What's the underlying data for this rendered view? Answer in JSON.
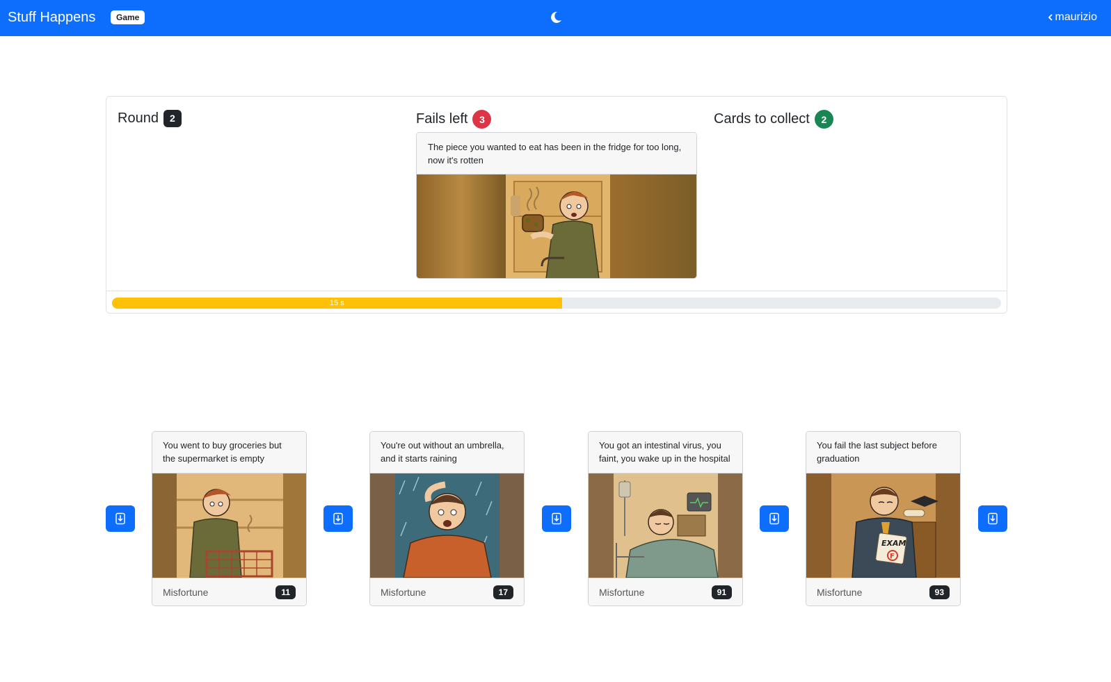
{
  "navbar": {
    "brand": "Stuff Happens",
    "badge": "Game",
    "theme_icon": "moon-icon",
    "user": "maurizio",
    "user_icon": "chevron-left-icon"
  },
  "game": {
    "round_label": "Round",
    "round_value": "2",
    "fails_label": "Fails left",
    "fails_value": "3",
    "collect_label": "Cards to collect",
    "collect_value": "2",
    "current_card": {
      "text": "The piece you wanted to eat has been in the fridge for too long, now it's rotten"
    },
    "timer": {
      "label": "15 s",
      "fraction": 0.506
    }
  },
  "hand": [
    {
      "text": "You went to buy groceries but the supermarket is empty",
      "category": "Misfortune",
      "index": "11"
    },
    {
      "text": "You're out without an umbrella, and it starts raining",
      "category": "Misfortune",
      "index": "17"
    },
    {
      "text": "You got an intestinal virus, you faint, you wake up in the hospital",
      "category": "Misfortune",
      "index": "91"
    },
    {
      "text": "You fail the last subject before graduation",
      "category": "Misfortune",
      "index": "93"
    }
  ],
  "colors": {
    "primary": "#0d6efd",
    "danger": "#dc3545",
    "success": "#198754",
    "warning": "#ffc107",
    "dark": "#212529"
  }
}
